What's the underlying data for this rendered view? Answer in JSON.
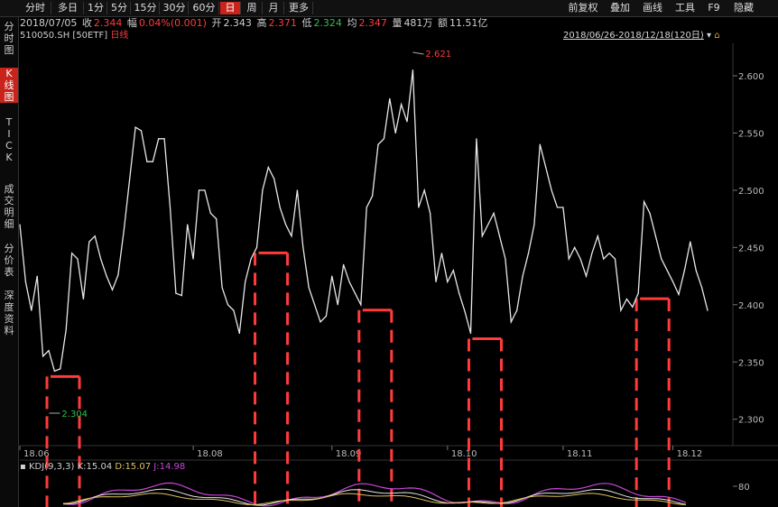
{
  "toolbar": {
    "periods": [
      {
        "label": "分时"
      },
      {
        "label": "多日"
      },
      {
        "label": "1分"
      },
      {
        "label": "5分"
      },
      {
        "label": "15分"
      },
      {
        "label": "30分"
      },
      {
        "label": "60分"
      },
      {
        "label": "日",
        "active": true
      },
      {
        "label": "周"
      },
      {
        "label": "月"
      },
      {
        "label": "更多"
      }
    ],
    "right": [
      {
        "label": "前复权"
      },
      {
        "label": "叠加"
      },
      {
        "label": "画线"
      },
      {
        "label": "工具"
      },
      {
        "label": "F9"
      },
      {
        "label": "隐藏"
      }
    ]
  },
  "sidebar": {
    "items": [
      {
        "label": "分时图"
      },
      {
        "label": "K线图",
        "active": true
      },
      {
        "label": "TICK"
      },
      {
        "label": "成交明细"
      },
      {
        "label": "分价表"
      },
      {
        "label": "深度资料"
      }
    ]
  },
  "quote": {
    "date": "2018/07/05",
    "close_label": "收",
    "close": "2.344",
    "change_label": "幅",
    "change": "0.04%(0.001)",
    "open_label": "开",
    "open": "2.343",
    "high_label": "高",
    "high": "2.371",
    "low_label": "低",
    "low": "2.324",
    "avg_label": "均",
    "avg": "2.347",
    "volume_label": "量",
    "volume": "481万",
    "amount_label": "额",
    "amount": "11.51亿"
  },
  "security": {
    "code": "510050.SH",
    "name": "[50ETF]",
    "period": "日线"
  },
  "range": "2018/06/26-2018/12/18(120日)",
  "kdj": {
    "label": "KDJ(9,3,3)",
    "k": "K:15.04",
    "d": "D:15.07",
    "j": "J:14.98"
  },
  "colors": {
    "price_line": "#e8e8e8",
    "highlight": "#ff3b3b",
    "low_marker": "#2fbf4f",
    "j_line": "#c846d8",
    "d_line": "#e0c060",
    "active": "#c8241b"
  },
  "chart_data": {
    "type": "line",
    "yticks": [
      "2.600",
      "2.550",
      "2.500",
      "2.450",
      "2.400",
      "2.350",
      "2.300"
    ],
    "xticks": [
      "18.06",
      "18.08",
      "18.09",
      "18.10",
      "18.11",
      "18.12"
    ],
    "ylim": [
      2.28,
      2.62
    ],
    "annotations": {
      "max": "2.621",
      "min": "2.304"
    },
    "kdj_tick": "80",
    "series": [
      {
        "values": [
          2.47,
          2.42,
          2.395,
          2.425,
          2.355,
          2.36,
          2.342,
          2.344,
          2.378,
          2.445,
          2.44,
          2.405,
          2.455,
          2.46,
          2.44,
          2.425,
          2.413,
          2.426,
          2.465,
          2.51,
          2.555,
          2.552,
          2.525,
          2.525,
          2.545,
          2.545,
          2.485,
          2.41,
          2.408,
          2.47,
          2.44,
          2.5,
          2.5,
          2.48,
          2.475,
          2.415,
          2.4,
          2.395,
          2.375,
          2.42,
          2.44,
          2.45,
          2.5,
          2.52,
          2.51,
          2.485,
          2.47,
          2.46,
          2.5,
          2.45,
          2.415,
          2.4,
          2.385,
          2.39,
          2.425,
          2.4,
          2.435,
          2.42,
          2.41,
          2.4,
          2.485,
          2.495,
          2.54,
          2.545,
          2.58,
          2.55,
          2.575,
          2.56,
          2.605,
          2.485,
          2.5,
          2.48,
          2.42,
          2.445,
          2.42,
          2.43,
          2.41,
          2.394,
          2.375,
          2.545,
          2.46,
          2.47,
          2.48,
          2.46,
          2.44,
          2.385,
          2.395,
          2.425,
          2.445,
          2.47,
          2.54,
          2.52,
          2.5,
          2.485,
          2.485,
          2.44,
          2.45,
          2.44,
          2.425,
          2.445,
          2.46,
          2.44,
          2.445,
          2.44,
          2.395,
          2.405,
          2.398,
          2.41,
          2.49,
          2.48,
          2.46,
          2.44,
          2.43,
          2.42,
          2.409,
          2.43,
          2.455,
          2.43,
          2.415,
          2.395
        ]
      }
    ]
  }
}
